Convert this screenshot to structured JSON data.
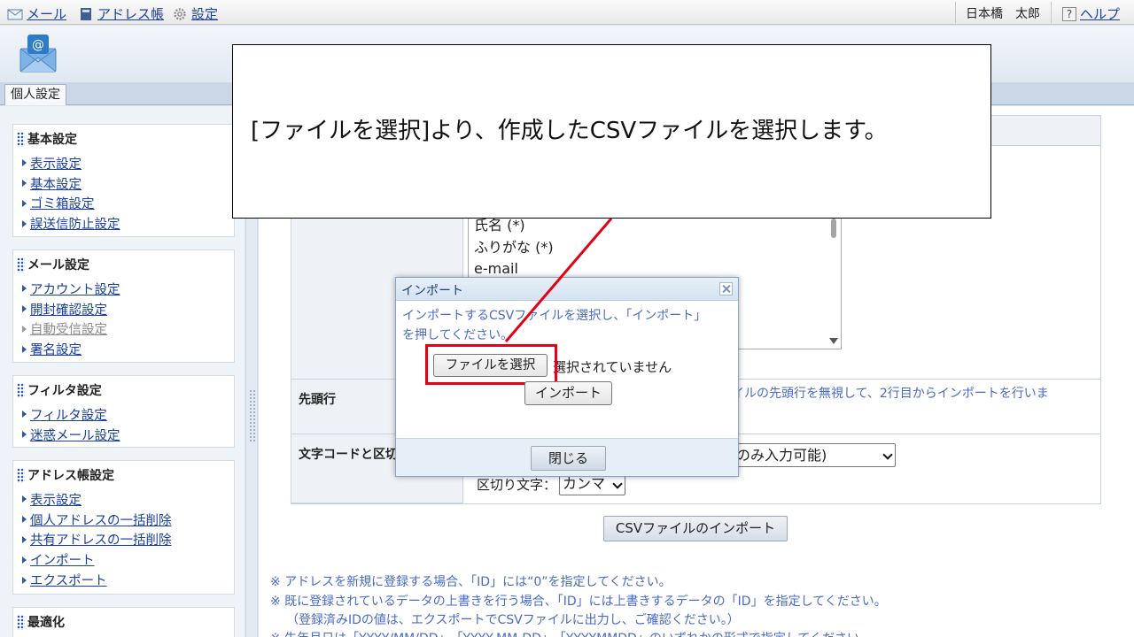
{
  "topbar": {
    "mail_label": "メール",
    "addressbook_label": "アドレス帳",
    "settings_label": "設定",
    "user_name": "日本橋　太郎",
    "help_label": "ヘルプ"
  },
  "tabs": {
    "personal_settings": "個人設定"
  },
  "sidebar": {
    "sections": [
      {
        "title": "基本設定",
        "items": [
          {
            "label": "表示設定"
          },
          {
            "label": "基本設定"
          },
          {
            "label": "ゴミ箱設定"
          },
          {
            "label": "誤送信防止設定"
          }
        ]
      },
      {
        "title": "メール設定",
        "items": [
          {
            "label": "アカウント設定"
          },
          {
            "label": "開封確認設定"
          },
          {
            "label": "自動受信設定"
          },
          {
            "label": "署名設定"
          }
        ]
      },
      {
        "title": "フィルタ設定",
        "items": [
          {
            "label": "フィルタ設定"
          },
          {
            "label": "迷惑メール設定"
          }
        ]
      },
      {
        "title": "アドレス帳設定",
        "items": [
          {
            "label": "表示設定"
          },
          {
            "label": "個人アドレスの一括削除"
          },
          {
            "label": "共有アドレスの一括削除"
          },
          {
            "label": "インポート"
          },
          {
            "label": "エクスポート"
          }
        ]
      },
      {
        "title": "最適化",
        "items": []
      }
    ]
  },
  "main": {
    "field_list": [
      "氏名 (*)",
      "ふりがな (*)",
      "e-mail"
    ],
    "first_row_label": "先頭行",
    "first_row_desc": "イルの先頭行を無視して、2行目からインポートを行いま",
    "encoding_label": "文字コードと区切",
    "encoding_value": "のみ入力可能)",
    "delimiter_label": "区切り文字：",
    "delimiter_value": "カンマ",
    "csv_import_button": "CSVファイルのインポート",
    "notes": [
      "※ アドレスを新規に登録する場合、「ID」には“0”を指定してください。",
      "※ 既に登録されているデータの上書きを行う場合、「ID」には上書きするデータの「ID」を指定してください。",
      "（登録済みIDの値は、エクスポートでCSVファイルに出力し、ご確認ください。）",
      "※ 生年月日は「YYYY/MM/DD」、「YYYY-MM-DD」、「YYYYMMDD」のいずれかの形式で指定してください。"
    ]
  },
  "callout": {
    "text": "[ファイルを選択]より、作成したCSVファイルを選択します。"
  },
  "dialog": {
    "title": "インポート",
    "message_line1": "インポートするCSVファイルを選択し、「インポート」",
    "message_line2": "を押してください。",
    "choose_file_button": "ファイルを選択",
    "no_file_text": "選択されていません",
    "import_button": "インポート",
    "close_button": "閉じる"
  },
  "colors": {
    "link": "#1a3fa3",
    "highlight": "#e60012",
    "info_text": "#4a6ac8"
  }
}
